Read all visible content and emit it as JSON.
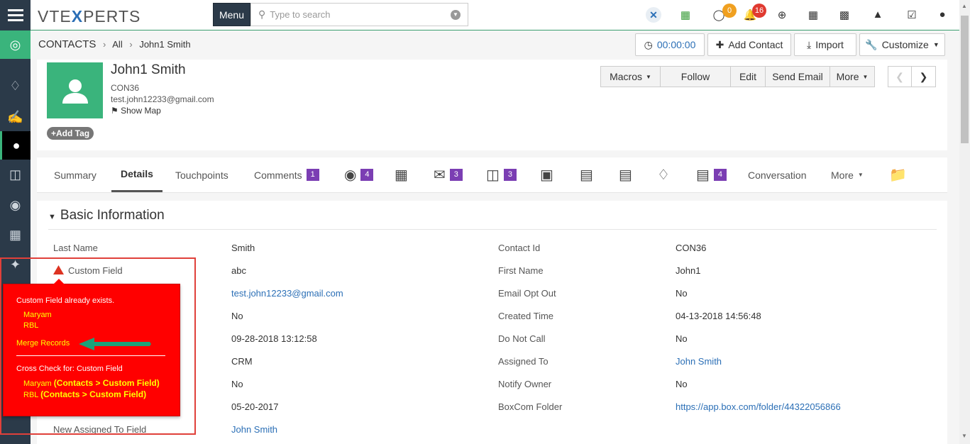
{
  "topbar": {
    "logo_pre": "VTE",
    "logo_x": "X",
    "logo_post": "PERTS",
    "menu_label": "Menu",
    "search_placeholder": "Type to search",
    "chat_count": "0",
    "notif_count": "16"
  },
  "breadcrumb": {
    "module": "CONTACTS",
    "filter": "All",
    "record": "John1 Smith"
  },
  "header_buttons": {
    "timer": "00:00:00",
    "add_contact": "Add Contact",
    "import": "Import",
    "customize": "Customize"
  },
  "record": {
    "name": "John1 Smith",
    "contact_no": "CON36",
    "email": "test.john12233@gmail.com",
    "show_map": "Show Map",
    "add_tag": "Add Tag"
  },
  "actions": {
    "macros": "Macros",
    "follow": "Follow",
    "edit": "Edit",
    "send_email": "Send Email",
    "more": "More"
  },
  "tabs": {
    "summary": "Summary",
    "details": "Details",
    "touchpoints": "Touchpoints",
    "comments": "Comments",
    "comments_count": "1",
    "money_count": "4",
    "email_count": "3",
    "tickets_count": "3",
    "docs_count": "4",
    "conversation": "Conversation",
    "more": "More"
  },
  "section": {
    "title": "Basic Information"
  },
  "fields": {
    "last_name_label": "Last Name",
    "last_name": "Smith",
    "custom_field_label": "Custom Field",
    "custom_field": "abc",
    "email": "test.john12233@gmail.com",
    "row3": "No",
    "row4": "09-28-2018 13:12:58",
    "row5": "CRM",
    "row6": "No",
    "row7": "05-20-2017",
    "new_assigned_label": "New Assigned To Field",
    "new_assigned": "John Smith",
    "contact_id_label": "Contact Id",
    "contact_id": "CON36",
    "first_name_label": "First Name",
    "first_name": "John1",
    "email_opt_out_label": "Email Opt Out",
    "email_opt_out": "No",
    "created_time_label": "Created Time",
    "created_time": "04-13-2018 14:56:48",
    "do_not_call_label": "Do Not Call",
    "do_not_call": "No",
    "assigned_to_label": "Assigned To",
    "assigned_to": "John Smith",
    "notify_owner_label": "Notify Owner",
    "notify_owner": "No",
    "boxcom_label": "BoxCom Folder",
    "boxcom": "https://app.box.com/folder/44322056866"
  },
  "popup": {
    "title": "Custom Field already exists.",
    "name1": "Maryam",
    "name2": "RBL",
    "merge": "Merge Records",
    "cross_check": "Cross Check for: Custom Field",
    "cc1_name": "Maryam",
    "cc1_rel": "(Contacts > Custom Field)",
    "cc2_name": "RBL",
    "cc2_rel": "(Contacts > Custom Field)"
  },
  "colors": {
    "accent": "#3ab47c",
    "sidebar": "#2b3a49",
    "link": "#2b6fb6",
    "popup": "#ff0000",
    "badge": "#7b3eb3"
  }
}
